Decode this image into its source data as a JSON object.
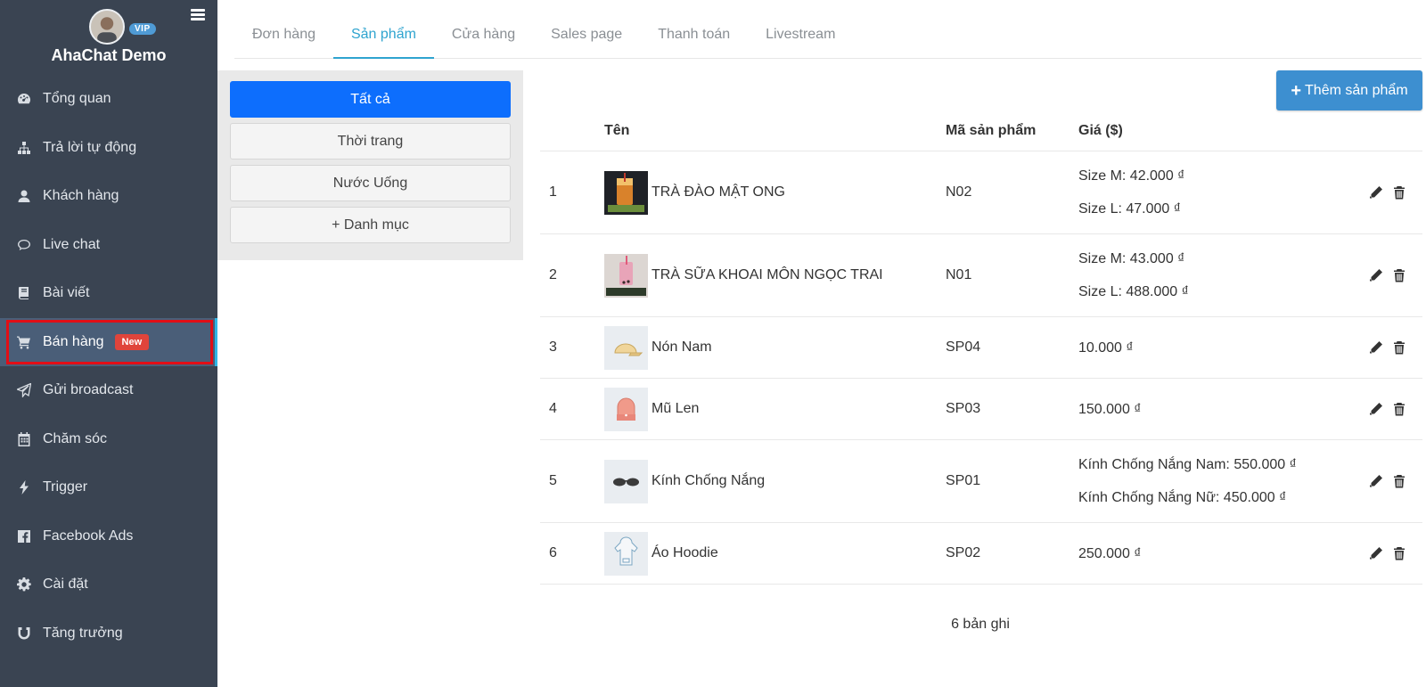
{
  "sidebar": {
    "brand": "AhaChat Demo",
    "vip_badge": "VIP",
    "items": [
      {
        "label": "Tổng quan",
        "icon": "dashboard-icon"
      },
      {
        "label": "Trả lời tự động",
        "icon": "sitemap-icon"
      },
      {
        "label": "Khách hàng",
        "icon": "user-icon"
      },
      {
        "label": "Live chat",
        "icon": "chat-bubble-icon"
      },
      {
        "label": "Bài viết",
        "icon": "book-icon"
      },
      {
        "label": "Bán hàng",
        "icon": "shopping-cart-icon",
        "badge": "New",
        "active": true
      },
      {
        "label": "Gửi broadcast",
        "icon": "paper-plane-icon"
      },
      {
        "label": "Chăm sóc",
        "icon": "calendar-icon"
      },
      {
        "label": "Trigger",
        "icon": "bolt-icon"
      },
      {
        "label": "Facebook Ads",
        "icon": "facebook-icon"
      },
      {
        "label": "Cài đặt",
        "icon": "gear-icon"
      },
      {
        "label": "Tăng trưởng",
        "icon": "magnet-icon"
      }
    ]
  },
  "tabs": [
    {
      "label": "Đơn hàng"
    },
    {
      "label": "Sản phẩm",
      "active": true
    },
    {
      "label": "Cửa hàng"
    },
    {
      "label": "Sales page"
    },
    {
      "label": "Thanh toán"
    },
    {
      "label": "Livestream"
    }
  ],
  "categories": [
    {
      "label": "Tất cả",
      "active": true
    },
    {
      "label": "Thời trang"
    },
    {
      "label": "Nước Uống"
    },
    {
      "label": "+ Danh mục"
    }
  ],
  "add_button": {
    "label": "Thêm sản phẩm"
  },
  "table": {
    "headers": {
      "name": "Tên",
      "code": "Mã sản phẩm",
      "price": "Giá ($)"
    },
    "rows": [
      {
        "idx": "1",
        "name": "TRÀ ĐÀO MẬT ONG",
        "code": "N02",
        "prices": [
          "Size M: 42.000 ₫",
          "Size L: 47.000 ₫"
        ],
        "thumb": "peach-tea-image"
      },
      {
        "idx": "2",
        "name": "TRÀ SỮA KHOAI MÔN NGỌC TRAI",
        "code": "N01",
        "prices": [
          "Size M: 43.000 ₫",
          "Size L: 488.000 ₫"
        ],
        "thumb": "taro-milk-tea-image"
      },
      {
        "idx": "3",
        "name": "Nón Nam",
        "code": "SP04",
        "prices": [
          "10.000 ₫"
        ],
        "thumb": "cap-image"
      },
      {
        "idx": "4",
        "name": "Mũ Len",
        "code": "SP03",
        "prices": [
          "150.000 ₫"
        ],
        "thumb": "beanie-image"
      },
      {
        "idx": "5",
        "name": "Kính Chống Nắng",
        "code": "SP01",
        "prices": [
          "Kính Chống Nắng Nam: 550.000 ₫",
          "Kính Chống Nắng Nữ: 450.000 ₫"
        ],
        "thumb": "sunglasses-image"
      },
      {
        "idx": "6",
        "name": "Áo Hoodie",
        "code": "SP02",
        "prices": [
          "250.000 ₫"
        ],
        "thumb": "hoodie-image"
      }
    ],
    "count_text": "6 bản ghi"
  }
}
